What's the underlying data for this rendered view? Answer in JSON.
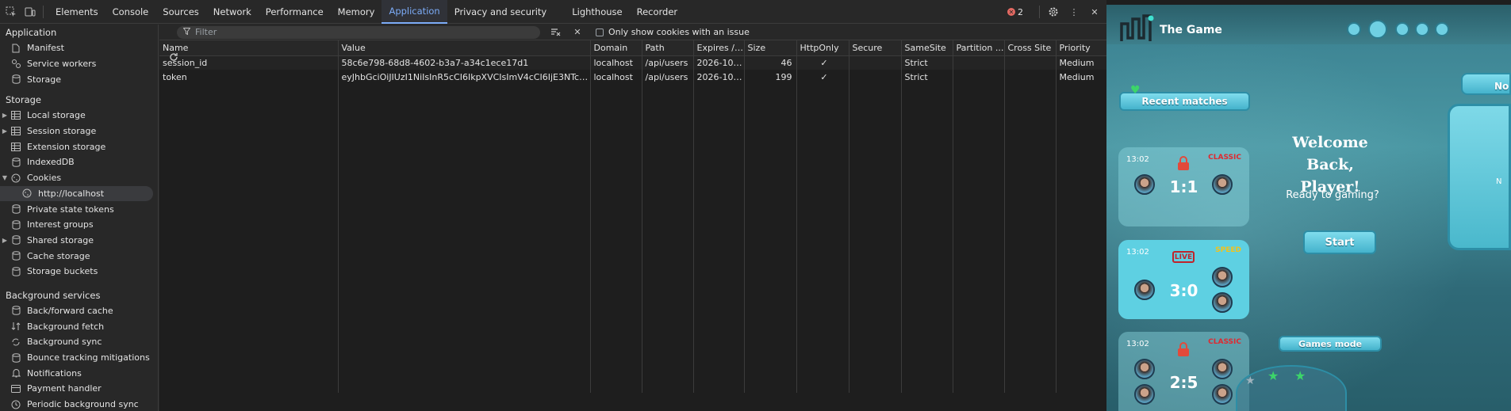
{
  "devtools": {
    "tabs": [
      "Elements",
      "Console",
      "Sources",
      "Network",
      "Performance",
      "Memory",
      "Application",
      "Privacy and security",
      "Lighthouse",
      "Recorder"
    ],
    "active_tab": "Application",
    "error_count": "2",
    "filter_placeholder": "Filter",
    "only_issue_label": "Only show cookies with an issue",
    "sidebar": {
      "application_header": "Application",
      "application_items": [
        "Manifest",
        "Service workers",
        "Storage"
      ],
      "storage_header": "Storage",
      "storage_items": [
        "Local storage",
        "Session storage",
        "Extension storage",
        "IndexedDB",
        "Cookies",
        "http://localhost",
        "Private state tokens",
        "Interest groups",
        "Shared storage",
        "Cache storage",
        "Storage buckets"
      ],
      "background_header": "Background services",
      "background_items": [
        "Back/forward cache",
        "Background fetch",
        "Background sync",
        "Bounce tracking mitigations",
        "Notifications",
        "Payment handler",
        "Periodic background sync"
      ]
    },
    "table": {
      "columns": [
        "Name",
        "Value",
        "Domain",
        "Path",
        "Expires / ...",
        "Size",
        "HttpOnly",
        "Secure",
        "SameSite",
        "Partition ...",
        "Cross Site",
        "Priority"
      ],
      "rows": [
        [
          "session_id",
          "58c6e798-68d8-4602-b3a7-a34c1ece17d1",
          "localhost",
          "/api/users",
          "2026-10-...",
          "46",
          "✓",
          "",
          "Strict",
          "",
          "",
          "Medium"
        ],
        [
          "token",
          "eyJhbGciOiJIUzI1NiIsInR5cCI6IkpXVCIsImV4cCI6IjE3NTc1OTQ...",
          "localhost",
          "/api/users",
          "2026-10-...",
          "199",
          "✓",
          "",
          "Strict",
          "",
          "",
          "Medium"
        ]
      ]
    }
  },
  "game": {
    "title": "The Game",
    "recent_matches": "Recent matches",
    "welcome": "Welcome Back, Player!",
    "ready": "Ready to gaming?",
    "start": "Start",
    "games_mode": "Games mode",
    "right_panel_label": "No",
    "right_panel_letter": "N",
    "matches": [
      {
        "time": "13:02",
        "mode": "CLASSIC",
        "score": "1:1",
        "mode_color": "#e0282f"
      },
      {
        "time": "13:02",
        "mode": "SPEED",
        "score": "3:0",
        "live": "LIVE",
        "mode_color": "#f2c21b"
      },
      {
        "time": "13:02",
        "mode": "CLASSIC",
        "score": "2:5",
        "mode_color": "#e0282f"
      }
    ]
  }
}
